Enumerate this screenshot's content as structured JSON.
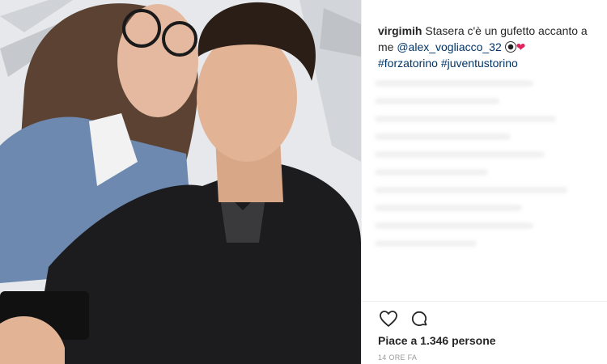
{
  "caption": {
    "username": "virgimih",
    "text_1": "Stasera c'è un gufetto accanto a me ",
    "mention": "@alex_vogliacco_32",
    "hashtag_1": "#forzatorino",
    "hashtag_2": "#juventustorino"
  },
  "actions": {
    "like_icon": "heart-outline",
    "comment_icon": "speech-bubble"
  },
  "likes_text": "Piace a 1.346 persone",
  "timestamp": "14 ORE FA",
  "colors": {
    "link": "#003569",
    "text": "#262626",
    "muted": "#999999"
  }
}
